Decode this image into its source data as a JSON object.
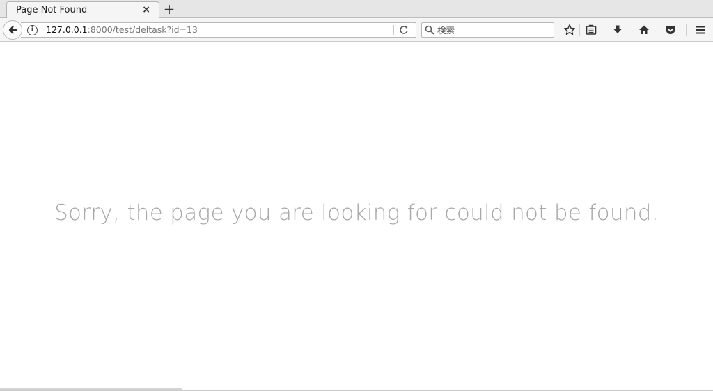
{
  "tab": {
    "title": "Page Not Found",
    "close_icon": "close-icon",
    "close_glyph": "×",
    "new_tab_glyph": "+"
  },
  "navbar": {
    "back_icon": "back-arrow-icon",
    "info_icon": "info-icon",
    "info_glyph": "i",
    "url_host": "127.0.0.1",
    "url_rest": ":8000/test/deltask?id=13",
    "reload_icon": "reload-icon",
    "search_placeholder": "検索",
    "search_icon": "search-icon"
  },
  "toolbar": {
    "icons": [
      "star-bookmark-icon",
      "reading-list-icon",
      "download-icon",
      "home-icon",
      "pocket-icon",
      "menu-icon"
    ]
  },
  "main": {
    "message": "Sorry, the page you are looking for could not be found."
  },
  "colors": {
    "message_text": "#a8a8a8",
    "chrome_bg": "#f5f5f5",
    "tabstrip_bg": "#e6e6e6"
  }
}
